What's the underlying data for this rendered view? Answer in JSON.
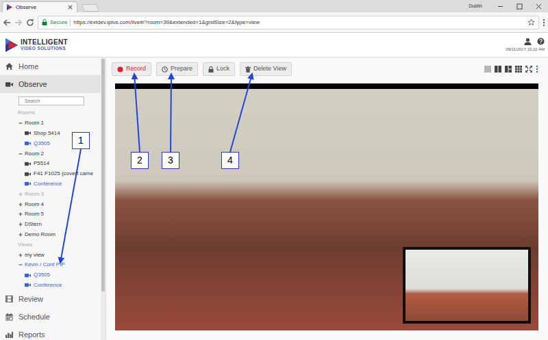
{
  "browser": {
    "tab": {
      "title": "Observe",
      "selected": true
    },
    "profile": "Dustin",
    "secure_label": "Secure",
    "url": "https://extdev.ipivs.com/live#/?room=39&extended=1&gridSize=2&type=view"
  },
  "header": {
    "logo_line1": "INTELLIGENT",
    "logo_line2": "VIDEO SOLUTIONS",
    "datetime": "09/11/2017 10:22 AM"
  },
  "sidebar": {
    "top": [
      {
        "label": "Home",
        "selected": false
      },
      {
        "label": "Observe",
        "selected": true
      }
    ],
    "search_placeholder": "Search",
    "tree": [
      {
        "kind": "heading",
        "label": "Rooms"
      },
      {
        "kind": "group",
        "label": "Room 1",
        "expanded": true,
        "selected": false,
        "disabled": false
      },
      {
        "kind": "camera",
        "label": "Shop 5414",
        "selected": false
      },
      {
        "kind": "camera",
        "label": "Q3505",
        "selected": true
      },
      {
        "kind": "group",
        "label": "Room 2",
        "expanded": true,
        "selected": false,
        "disabled": false
      },
      {
        "kind": "camera",
        "label": "P5514",
        "selected": false
      },
      {
        "kind": "camera",
        "label": "F41 F1025 (covert came",
        "selected": false
      },
      {
        "kind": "camera",
        "label": "Conference",
        "selected": true
      },
      {
        "kind": "group",
        "label": "Room 3",
        "expanded": false,
        "selected": false,
        "disabled": true
      },
      {
        "kind": "group",
        "label": "Room 4",
        "expanded": false,
        "selected": false,
        "disabled": false
      },
      {
        "kind": "group",
        "label": "Room 5",
        "expanded": false,
        "selected": false,
        "disabled": false
      },
      {
        "kind": "group",
        "label": "DStern",
        "expanded": false,
        "selected": false,
        "disabled": false
      },
      {
        "kind": "group",
        "label": "Demo Room",
        "expanded": false,
        "selected": false,
        "disabled": false
      },
      {
        "kind": "heading",
        "label": "Views"
      },
      {
        "kind": "group",
        "label": "my view",
        "expanded": false,
        "selected": false,
        "disabled": false
      },
      {
        "kind": "group",
        "label": "Kevin / Conf PIP",
        "expanded": true,
        "selected": true,
        "disabled": false
      },
      {
        "kind": "camera",
        "label": "Q3505",
        "selected": true
      },
      {
        "kind": "camera",
        "label": "Conference",
        "selected": true
      }
    ],
    "bottom": [
      {
        "label": "Review",
        "selected": false
      },
      {
        "label": "Schedule",
        "selected": false
      },
      {
        "label": "Reports",
        "selected": false
      }
    ]
  },
  "toolbar": {
    "buttons": [
      {
        "label": "Record",
        "kind": "record"
      },
      {
        "label": "Prepare",
        "kind": "action"
      },
      {
        "label": "Lock",
        "kind": "action"
      },
      {
        "label": "Delete View",
        "kind": "action"
      }
    ],
    "layouts": [
      {
        "disabled": true
      },
      {
        "disabled": false
      },
      {
        "disabled": false
      },
      {
        "disabled": false
      },
      {
        "disabled": false
      }
    ]
  },
  "callouts": [
    {
      "label": "1"
    },
    {
      "label": "2"
    },
    {
      "label": "3"
    },
    {
      "label": "4"
    }
  ]
}
